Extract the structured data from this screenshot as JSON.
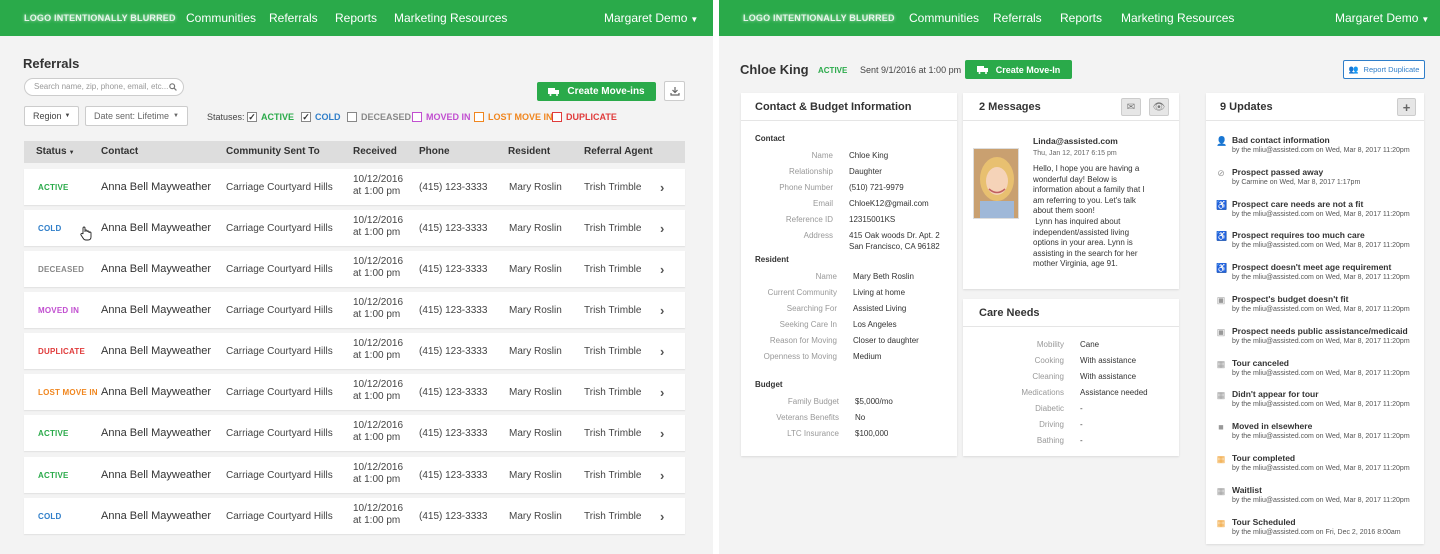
{
  "brand": {
    "green": "#2aaa4a",
    "logo": "LOGO INTENTIONALLY BLURRED"
  },
  "nav": {
    "communities": "Communities",
    "referrals": "Referrals",
    "reports": "Reports",
    "marketing": "Marketing Resources",
    "user": "Margaret Demo"
  },
  "list": {
    "title": "Referrals",
    "search_placeholder": "Search name, zip, phone, email, etc...",
    "create_label": "Create Move-ins",
    "region_label": "Region",
    "date_label": "Date sent: Lifetime",
    "statuses_label": "Statuses:",
    "statuses": [
      {
        "label": "ACTIVE",
        "checked": true,
        "color": "#2aaa4a"
      },
      {
        "label": "COLD",
        "checked": true,
        "color": "#2f7ec9"
      },
      {
        "label": "DECEASED",
        "checked": false,
        "color": "#888888"
      },
      {
        "label": "MOVED IN",
        "checked": false,
        "color": "#c14fd0"
      },
      {
        "label": "LOST MOVE IN",
        "checked": false,
        "color": "#f0861f"
      },
      {
        "label": "DUPLICATE",
        "checked": false,
        "color": "#e03b3b"
      }
    ],
    "columns": [
      "Status",
      "Contact",
      "Community Sent To",
      "Received",
      "Phone",
      "Resident",
      "Referral Agent"
    ],
    "rows": [
      {
        "status": "ACTIVE",
        "color": "#2aaa4a",
        "contact": "Anna Bell Mayweather",
        "community": "Carriage Courtyard Hills",
        "date": "10/12/2016",
        "time": "at 1:00 pm",
        "phone": "(415) 123-3333",
        "resident": "Mary Roslin",
        "agent": "Trish Trimble"
      },
      {
        "status": "COLD",
        "color": "#2f7ec9",
        "contact": "Anna Bell Mayweather",
        "community": "Carriage Courtyard Hills",
        "date": "10/12/2016",
        "time": "at 1:00 pm",
        "phone": "(415) 123-3333",
        "resident": "Mary Roslin",
        "agent": "Trish Trimble"
      },
      {
        "status": "DECEASED",
        "color": "#888888",
        "contact": "Anna Bell Mayweather",
        "community": "Carriage Courtyard Hills",
        "date": "10/12/2016",
        "time": "at 1:00 pm",
        "phone": "(415) 123-3333",
        "resident": "Mary Roslin",
        "agent": "Trish Trimble"
      },
      {
        "status": "MOVED IN",
        "color": "#c14fd0",
        "contact": "Anna Bell Mayweather",
        "community": "Carriage Courtyard Hills",
        "date": "10/12/2016",
        "time": "at 1:00 pm",
        "phone": "(415) 123-3333",
        "resident": "Mary Roslin",
        "agent": "Trish Trimble"
      },
      {
        "status": "DUPLICATE",
        "color": "#e03b3b",
        "contact": "Anna Bell Mayweather",
        "community": "Carriage Courtyard Hills",
        "date": "10/12/2016",
        "time": "at 1:00 pm",
        "phone": "(415) 123-3333",
        "resident": "Mary Roslin",
        "agent": "Trish Trimble"
      },
      {
        "status": "LOST MOVE IN",
        "color": "#f0861f",
        "contact": "Anna Bell Mayweather",
        "community": "Carriage Courtyard Hills",
        "date": "10/12/2016",
        "time": "at 1:00 pm",
        "phone": "(415) 123-3333",
        "resident": "Mary Roslin",
        "agent": "Trish Trimble"
      },
      {
        "status": "ACTIVE",
        "color": "#2aaa4a",
        "contact": "Anna Bell Mayweather",
        "community": "Carriage Courtyard Hills",
        "date": "10/12/2016",
        "time": "at 1:00 pm",
        "phone": "(415) 123-3333",
        "resident": "Mary Roslin",
        "agent": "Trish Trimble"
      },
      {
        "status": "ACTIVE",
        "color": "#2aaa4a",
        "contact": "Anna Bell Mayweather",
        "community": "Carriage Courtyard Hills",
        "date": "10/12/2016",
        "time": "at 1:00 pm",
        "phone": "(415) 123-3333",
        "resident": "Mary Roslin",
        "agent": "Trish Trimble"
      },
      {
        "status": "COLD",
        "color": "#2f7ec9",
        "contact": "Anna Bell Mayweather",
        "community": "Carriage Courtyard Hills",
        "date": "10/12/2016",
        "time": "at 1:00 pm",
        "phone": "(415) 123-3333",
        "resident": "Mary Roslin",
        "agent": "Trish Trimble"
      }
    ]
  },
  "detail": {
    "name": "Chloe King",
    "status": "ACTIVE",
    "sent": "Sent 9/1/2016 at 1:00 pm",
    "create_label": "Create Move-In",
    "report_label": "Report Duplicate",
    "contact_card": {
      "title": "Contact & Budget Information",
      "contact_heading": "Contact",
      "contact": [
        {
          "k": "Name",
          "v": "Chloe King"
        },
        {
          "k": "Relationship",
          "v": "Daughter"
        },
        {
          "k": "Phone Number",
          "v": "(510) 721-9979"
        },
        {
          "k": "Email",
          "v": "ChloeK12@gmail.com"
        },
        {
          "k": "Reference ID",
          "v": "12315001KS"
        },
        {
          "k": "Address",
          "v": "415 Oak woods Dr. Apt. 2",
          "v2": "San Francisco, CA 96182"
        }
      ],
      "resident_heading": "Resident",
      "resident": [
        {
          "k": "Name",
          "v": "Mary Beth Roslin"
        },
        {
          "k": "Current Community",
          "v": "Living at home"
        },
        {
          "k": "Searching For",
          "v": "Assisted Living"
        },
        {
          "k": "Seeking Care In",
          "v": "Los Angeles"
        },
        {
          "k": "Reason for Moving",
          "v": "Closer to daughter"
        },
        {
          "k": "Openness to Moving",
          "v": "Medium"
        }
      ],
      "budget_heading": "Budget",
      "budget": [
        {
          "k": "Family Budget",
          "v": "$5,000/mo"
        },
        {
          "k": "Veterans Benefits",
          "v": "No"
        },
        {
          "k": "LTC Insurance",
          "v": "$100,000"
        }
      ]
    },
    "messages": {
      "title": "2 Messages",
      "from": "Linda@assisted.com",
      "time": "Thu, Jan 12, 2017 6:15 pm",
      "body": [
        "Hello, I hope you are having a",
        "wonderful day! Below is",
        "information about a family that I",
        "am referring to you. Let's talk",
        "about them soon!",
        " Lynn has inquired about",
        "independent/assisted living",
        "options in your area. Lynn is",
        "assisting in the search for her",
        "mother Virginia, age 91."
      ]
    },
    "care": {
      "title": "Care Needs",
      "items": [
        {
          "k": "Mobility",
          "v": "Cane"
        },
        {
          "k": "Cooking",
          "v": "With assistance"
        },
        {
          "k": "Cleaning",
          "v": "With assistance"
        },
        {
          "k": "Medications",
          "v": "Assistance needed"
        },
        {
          "k": "Diabetic",
          "v": "-"
        },
        {
          "k": "Driving",
          "v": "-"
        },
        {
          "k": "Bathing",
          "v": "-"
        }
      ]
    },
    "updates": {
      "title": "9 Updates",
      "items": [
        {
          "icon": "user-remove-icon",
          "glyph": "👤",
          "t": "Bad contact information",
          "s": "by the mliu@assisted.com on Wed, Mar 8, 2017 11:20pm",
          "color": "#999999"
        },
        {
          "icon": "blocked-icon",
          "glyph": "⊘",
          "t": "Prospect passed away",
          "s": "by Carmine on Wed, Mar 8, 2017 1:17pm",
          "color": "#999999"
        },
        {
          "icon": "wheelchair-icon",
          "glyph": "♿",
          "t": "Prospect care needs are not a fit",
          "s": "by the mliu@assisted.com on Wed, Mar 8, 2017 11:20pm",
          "color": "#999999"
        },
        {
          "icon": "wheelchair-icon",
          "glyph": "♿",
          "t": "Prospect requires too much care",
          "s": "by the mliu@assisted.com on Wed, Mar 8, 2017 11:20pm",
          "color": "#999999"
        },
        {
          "icon": "wheelchair-icon",
          "glyph": "♿",
          "t": "Prospect doesn't meet age requirement",
          "s": "by the mliu@assisted.com on Wed, Mar 8, 2017 11:20pm",
          "color": "#999999"
        },
        {
          "icon": "money-icon",
          "glyph": "▣",
          "t": "Prospect's budget doesn't fit",
          "s": "by the mliu@assisted.com on Wed, Mar 8, 2017 11:20pm",
          "color": "#999999"
        },
        {
          "icon": "money-icon",
          "glyph": "▣",
          "t": "Prospect needs public assistance/medicaid",
          "s": "by the mliu@assisted.com on Wed, Mar 8, 2017 11:20pm",
          "color": "#999999"
        },
        {
          "icon": "calendar-icon",
          "glyph": "▦",
          "t": "Tour canceled",
          "s": "by the mliu@assisted.com on Wed, Mar 8, 2017 11:20pm",
          "color": "#999999"
        },
        {
          "icon": "calendar-icon",
          "glyph": "▦",
          "t": "Didn't appear for tour",
          "s": "by the mliu@assisted.com on Wed, Mar 8, 2017 11:20pm",
          "color": "#999999"
        },
        {
          "icon": "truck-icon",
          "glyph": "■",
          "t": "Moved in elsewhere",
          "s": "by the mliu@assisted.com on Wed, Mar 8, 2017 11:20pm",
          "color": "#999999"
        },
        {
          "icon": "calendar-icon",
          "glyph": "▦",
          "t": "Tour completed",
          "s": "by the mliu@assisted.com on Wed, Mar 8, 2017 11:20pm",
          "color": "#f0a030"
        },
        {
          "icon": "calendar-icon",
          "glyph": "▦",
          "t": "Waitlist",
          "s": "by the mliu@assisted.com on Wed, Mar 8, 2017 11:20pm",
          "color": "#999999"
        },
        {
          "icon": "calendar-icon",
          "glyph": "▦",
          "t": "Tour Scheduled",
          "s": "by the mliu@assisted.com on Fri, Dec 2, 2016 8:00am",
          "color": "#f0a030"
        }
      ]
    }
  }
}
